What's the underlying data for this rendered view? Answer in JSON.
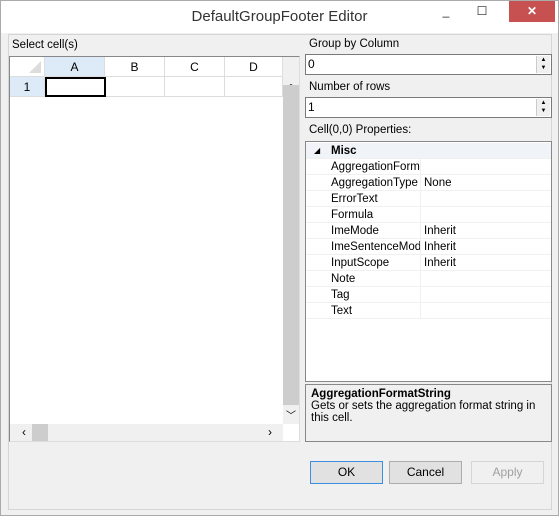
{
  "window": {
    "title": "DefaultGroupFooter Editor",
    "minimize": "_",
    "maximize": "☐",
    "close": "✕"
  },
  "left": {
    "label": "Select cell(s)",
    "columns": [
      "A",
      "B",
      "C",
      "D"
    ],
    "rows": [
      "1"
    ]
  },
  "right": {
    "group_by_label": "Group by Column",
    "group_by_value": "0",
    "rows_label": "Number of rows",
    "rows_value": "1",
    "props_label": "Cell(0,0) Properties:",
    "category": "Misc",
    "properties": [
      {
        "name": "AggregationFormatString",
        "value": ""
      },
      {
        "name": "AggregationType",
        "value": "None"
      },
      {
        "name": "ErrorText",
        "value": ""
      },
      {
        "name": "Formula",
        "value": ""
      },
      {
        "name": "ImeMode",
        "value": "Inherit"
      },
      {
        "name": "ImeSentenceMode",
        "value": "Inherit"
      },
      {
        "name": "InputScope",
        "value": "Inherit"
      },
      {
        "name": "Note",
        "value": ""
      },
      {
        "name": "Tag",
        "value": ""
      },
      {
        "name": "Text",
        "value": ""
      }
    ],
    "desc_title": "AggregationFormatString",
    "desc_text": "Gets or sets the aggregation format string in this cell."
  },
  "buttons": {
    "ok": "OK",
    "cancel": "Cancel",
    "apply": "Apply"
  }
}
